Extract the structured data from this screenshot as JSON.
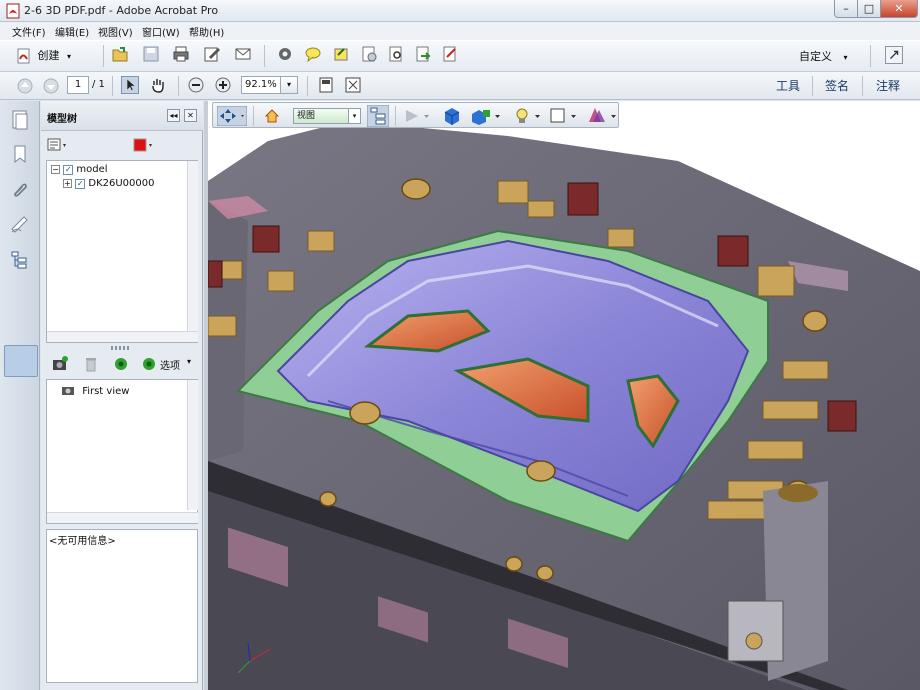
{
  "window": {
    "title": "2-6 3D PDF.pdf - Adobe Acrobat Pro",
    "minimize": "–",
    "maximize": "□",
    "close": "✕"
  },
  "menu": [
    "文件(F)",
    "编辑(E)",
    "视图(V)",
    "窗口(W)",
    "帮助(H)"
  ],
  "toolbar": {
    "create_label": "创建",
    "customize_label": "自定义",
    "icons": [
      "open-icon",
      "save-icon",
      "print-icon",
      "edit-icon",
      "email-icon",
      "settings-icon",
      "comment-icon",
      "highlight-icon",
      "attach-icon",
      "search-icon",
      "export-icon",
      "form-icon"
    ]
  },
  "navigation": {
    "page_current": "1",
    "page_total": "/ 1",
    "zoom": "92.1%"
  },
  "right_links": {
    "tools": "工具",
    "sign": "签名",
    "comment": "注释"
  },
  "sidebar": {
    "panel_title": "模型树",
    "tree": [
      {
        "label": "model",
        "checked": true,
        "expanded": true
      },
      {
        "label": "DK26U00000",
        "checked": true,
        "expanded": false
      }
    ],
    "views_options_label": "选项",
    "views": [
      "First view"
    ],
    "info_text": "<无可用信息>"
  },
  "toolbar3d": {
    "view_label": "视图"
  },
  "colors": {
    "accent_red": "#e01010",
    "panel_purple": "#8c86d8",
    "mount_green": "#8fcf95",
    "base_gray": "#6f6c79",
    "insert_orange": "#e0683c",
    "brass": "#c9a45a"
  }
}
